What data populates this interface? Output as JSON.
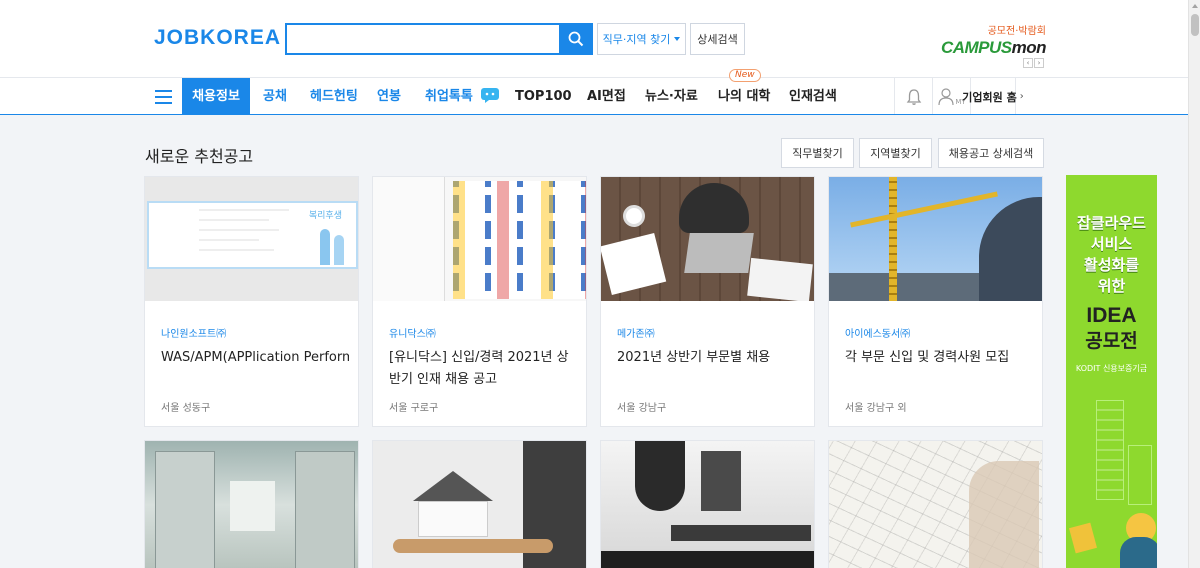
{
  "header": {
    "logo": "JOBKOREA",
    "search_value": "",
    "find_button": "직무·지역 찾기",
    "detail_search": "상세검색",
    "campus_sub": "공모전·박람회",
    "campus_brand_a": "CAMPUS",
    "campus_brand_b": "mon",
    "icons": {
      "search": "search-icon",
      "caret": "chevron-down-icon"
    }
  },
  "nav": {
    "items": [
      "채용정보",
      "공채",
      "헤드헌팅",
      "연봉",
      "취업톡톡",
      "TOP100",
      "AI면접",
      "뉴스·자료",
      "나의 대학",
      "인재검색"
    ],
    "new_badge": "New",
    "my_label": "MY",
    "company_home": "기업회원 홈",
    "colors": {
      "accent": "#1a87e8",
      "badge": "#e55a1c"
    }
  },
  "section": {
    "title": "새로운 추천공고",
    "buttons": [
      "직무별찾기",
      "지역별찾기",
      "채용공고 상세검색"
    ]
  },
  "cards": [
    {
      "company": "나인원소프트㈜",
      "title": "WAS/APM(APPlication Performance Monitoring) 영업...",
      "location": "서울 성동구",
      "thumb_caption": "복리후생"
    },
    {
      "company": "유니닥스㈜",
      "title": "[유니닥스] 신입/경력 2021년 상반기 인재 채용 공고",
      "location": "서울 구로구"
    },
    {
      "company": "메가존㈜",
      "title": "2021년 상반기 부문별 채용",
      "location": "서울 강남구"
    },
    {
      "company": "아이에스동서㈜",
      "title": "각 부문 신입 및 경력사원 모집",
      "location": "서울 강남구 외"
    }
  ],
  "ad": {
    "lines": [
      "잡클라우드",
      "서비스",
      "활성화를",
      "위한"
    ],
    "idea": "IDEA",
    "contest": "공모전",
    "org": "KODIT 신용보증기금"
  }
}
